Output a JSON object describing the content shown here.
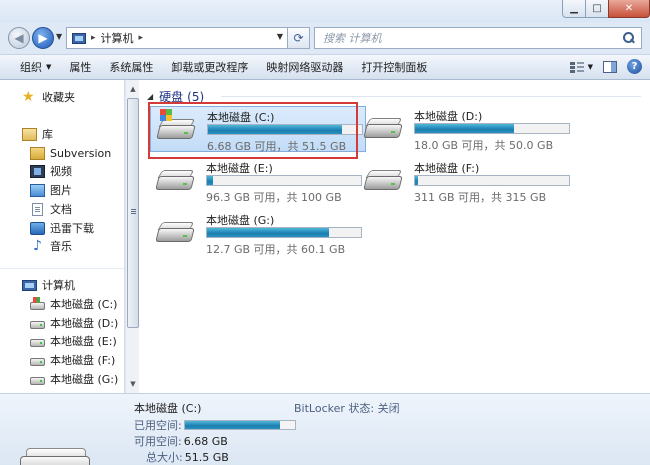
{
  "window": {
    "min_glyph": "▁",
    "max_glyph": "□",
    "close_glyph": "✕"
  },
  "address": {
    "crumb": "计算机",
    "separator": "▸"
  },
  "search": {
    "placeholder": "搜索 计算机"
  },
  "toolbar": {
    "organize": "组织",
    "properties": "属性",
    "system_properties": "系统属性",
    "uninstall": "卸载或更改程序",
    "map_drive": "映射网络驱动器",
    "control_panel": "打开控制面板",
    "help_glyph": "?"
  },
  "nav": {
    "favorites": "收藏夹",
    "libraries": "库",
    "library_items": [
      "Subversion",
      "视频",
      "图片",
      "文档",
      "迅雷下载",
      "音乐"
    ],
    "computer": "计算机",
    "drives": [
      "本地磁盘 (C:)",
      "本地磁盘 (D:)",
      "本地磁盘 (E:)",
      "本地磁盘 (F:)",
      "本地磁盘 (G:)"
    ]
  },
  "group": {
    "title": "硬盘",
    "count": "(5)"
  },
  "drives": [
    {
      "name": "本地磁盘 (C:)",
      "info": "6.68 GB 可用，共 51.5 GB",
      "used_fraction": 0.87,
      "selected": true
    },
    {
      "name": "本地磁盘 (D:)",
      "info": "18.0 GB 可用，共 50.0 GB",
      "used_fraction": 0.64,
      "selected": false
    },
    {
      "name": "本地磁盘 (E:)",
      "info": "96.3 GB 可用，共 100 GB",
      "used_fraction": 0.04,
      "selected": false
    },
    {
      "name": "本地磁盘 (F:)",
      "info": "311 GB 可用，共 315 GB",
      "used_fraction": 0.02,
      "selected": false
    },
    {
      "name": "本地磁盘 (G:)",
      "info": "12.7 GB 可用，共 60.1 GB",
      "used_fraction": 0.79,
      "selected": false
    }
  ],
  "details": {
    "title": "本地磁盘 (C:)",
    "used_label": "已用空间:",
    "free_label": "可用空间:",
    "free_value": "6.68 GB",
    "total_label": "总大小:",
    "total_value": "51.5 GB",
    "bitlocker": "BitLocker 状态: 关闭",
    "used_fraction": 0.87
  },
  "colors": {
    "bar_fill": "#1a7fb0",
    "highlight": "#d43a37",
    "selection": "#c2dcf7"
  }
}
